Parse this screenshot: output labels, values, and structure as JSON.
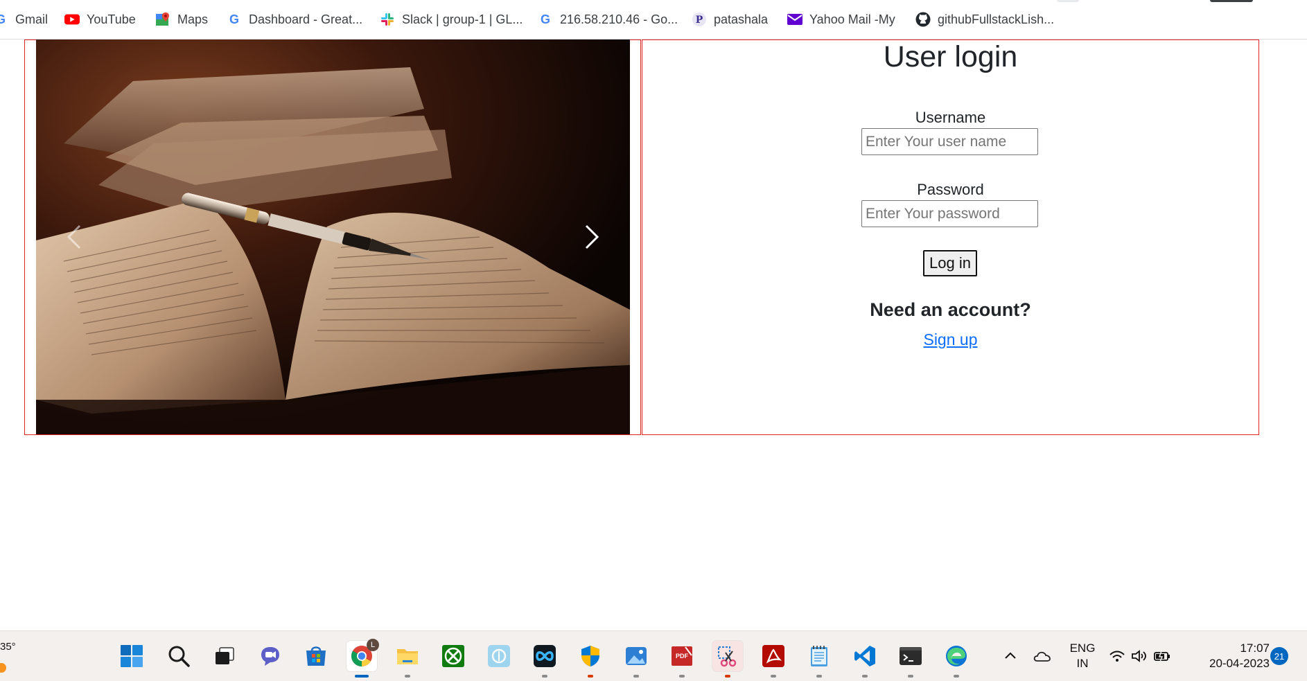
{
  "bookmarks": [
    {
      "label": "Gmail",
      "icon": "gmail-icon"
    },
    {
      "label": "YouTube",
      "icon": "youtube-icon"
    },
    {
      "label": "Maps",
      "icon": "maps-icon"
    },
    {
      "label": "Dashboard - Great...",
      "icon": "google-icon"
    },
    {
      "label": "Slack | group-1 | GL...",
      "icon": "slack-icon"
    },
    {
      "label": "216.58.210.46 - Go...",
      "icon": "google-icon"
    },
    {
      "label": "patashala",
      "icon": "patashala-icon"
    },
    {
      "label": "Yahoo Mail -My",
      "icon": "yahoo-mail-icon"
    },
    {
      "label": "githubFullstackLish...",
      "icon": "github-icon"
    }
  ],
  "login": {
    "title": "User login",
    "username_label": "Username",
    "username_placeholder": "Enter Your user name",
    "password_label": "Password",
    "password_placeholder": "Enter Your password",
    "login_button": "Log in",
    "need_account": "Need an account?",
    "signup_link": "Sign up"
  },
  "carousel": {
    "image_icon": "open-book-with-pen-photo",
    "prev_icon": "chevron-left-icon",
    "next_icon": "chevron-right-icon"
  },
  "taskbar": {
    "weather": "35°",
    "apps": [
      "start-icon",
      "search-icon",
      "task-view-icon",
      "teams-chat-icon",
      "microsoft-store-icon",
      "chrome-icon",
      "file-explorer-icon",
      "xbox-icon",
      "photos-legacy-icon",
      "clipchamp-icon",
      "windows-security-icon",
      "photos-icon",
      "pdf-editor-icon",
      "snipping-tool-icon",
      "acrobat-icon",
      "notepad-icon",
      "vscode-icon",
      "terminal-icon",
      "edge-icon"
    ],
    "chrome_profile_badge": "L",
    "language_line1": "ENG",
    "language_line2": "IN",
    "time": "17:07",
    "date": "20-04-2023",
    "notifications": "21"
  },
  "colors": {
    "frame_border": "#e02424",
    "link": "#0d6efd",
    "taskbar_bg": "#f3f0ee"
  }
}
